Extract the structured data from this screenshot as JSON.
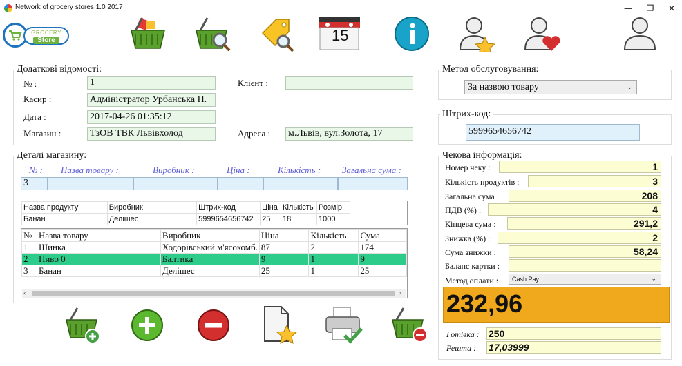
{
  "window": {
    "title": "Network of grocery stores 1.0 2017",
    "minimize": "—",
    "maximize": "❐",
    "close": "✕"
  },
  "logo": {
    "line1": "GROCERY",
    "line2": "Store"
  },
  "toolbar": {
    "icons": [
      "basket-delete-icon",
      "basket-search-icon",
      "price-tag-search-icon",
      "calendar-icon",
      "info-icon",
      "user-star-icon",
      "user-heart-icon",
      "user-icon"
    ],
    "calendar_day": "15"
  },
  "details": {
    "legend": "Додаткові відомості:",
    "no_label": "№ :",
    "no_value": "1",
    "cashier_label": "Касир :",
    "cashier_value": "Адміністратор Урбанська Н.",
    "date_label": "Дата :",
    "date_value": "2017-04-26 01:35:12",
    "shop_label": "Магазин :",
    "shop_value": "ТзОВ ТВК Львівхолод",
    "client_label": "Клієнт :",
    "client_value": "",
    "address_label": "Адреса :",
    "address_value": "м.Львів, вул.Золота, 17"
  },
  "shop_details": {
    "legend": "Деталі магазину:",
    "headers": [
      "№ :",
      "Назва товару :",
      "Виробник :",
      "Ціна :",
      "Кількість :",
      "Загальна сума :"
    ],
    "inputs": [
      "3",
      "",
      "",
      "",
      "",
      ""
    ],
    "product_grid": {
      "columns": [
        "Назва продукту",
        "Виробник",
        "Штрих-код",
        "Ціна",
        "Кількість",
        "Розмір"
      ],
      "rows": [
        [
          "Банан",
          "Делішес",
          "5999654656742",
          "25",
          "18",
          "1000"
        ]
      ]
    },
    "cart_grid": {
      "columns": [
        "№",
        "Назва товару",
        "Виробник",
        "Ціна",
        "Кількість",
        "Сума"
      ],
      "rows": [
        [
          "1",
          "Шинка",
          "Ходорівський м'ясокомб.",
          "87",
          "2",
          "174"
        ],
        [
          "2",
          "Пиво 0",
          "Балтика",
          "9",
          "1",
          "9"
        ],
        [
          "3",
          "Банан",
          "Делішес",
          "25",
          "1",
          "25"
        ]
      ],
      "selected_row": 1
    }
  },
  "bottom_buttons": [
    "basket-add-icon",
    "plus-icon",
    "minus-icon",
    "document-star-icon",
    "printer-check-icon",
    "basket-remove-icon"
  ],
  "service": {
    "legend": "Метод обслуговування:",
    "selected": "За назвою товару"
  },
  "barcode": {
    "legend": "Штрих-код:",
    "value": "5999654656742"
  },
  "receipt": {
    "legend": "Чекова інформація:",
    "rows": [
      {
        "label": "Номер чеку :",
        "value": "1"
      },
      {
        "label": "Кількість продуктів :",
        "value": "3"
      },
      {
        "label": "Загальна сума :",
        "value": "208"
      },
      {
        "label": "ПДВ (%) :",
        "value": "4"
      },
      {
        "label": "Кінцева сума :",
        "value": "291,2"
      },
      {
        "label": "Знижка (%) :",
        "value": "2"
      },
      {
        "label": "Сума знижки :",
        "value": "58,24"
      },
      {
        "label": "Баланс картки :",
        "value": ""
      }
    ],
    "payment_label": "Метод оплати :",
    "payment_value": "Cash Pay",
    "total": "232,96",
    "cash_label": "Готівка :",
    "cash_value": "250",
    "change_label": "Решта :",
    "change_value": "17,03999"
  }
}
